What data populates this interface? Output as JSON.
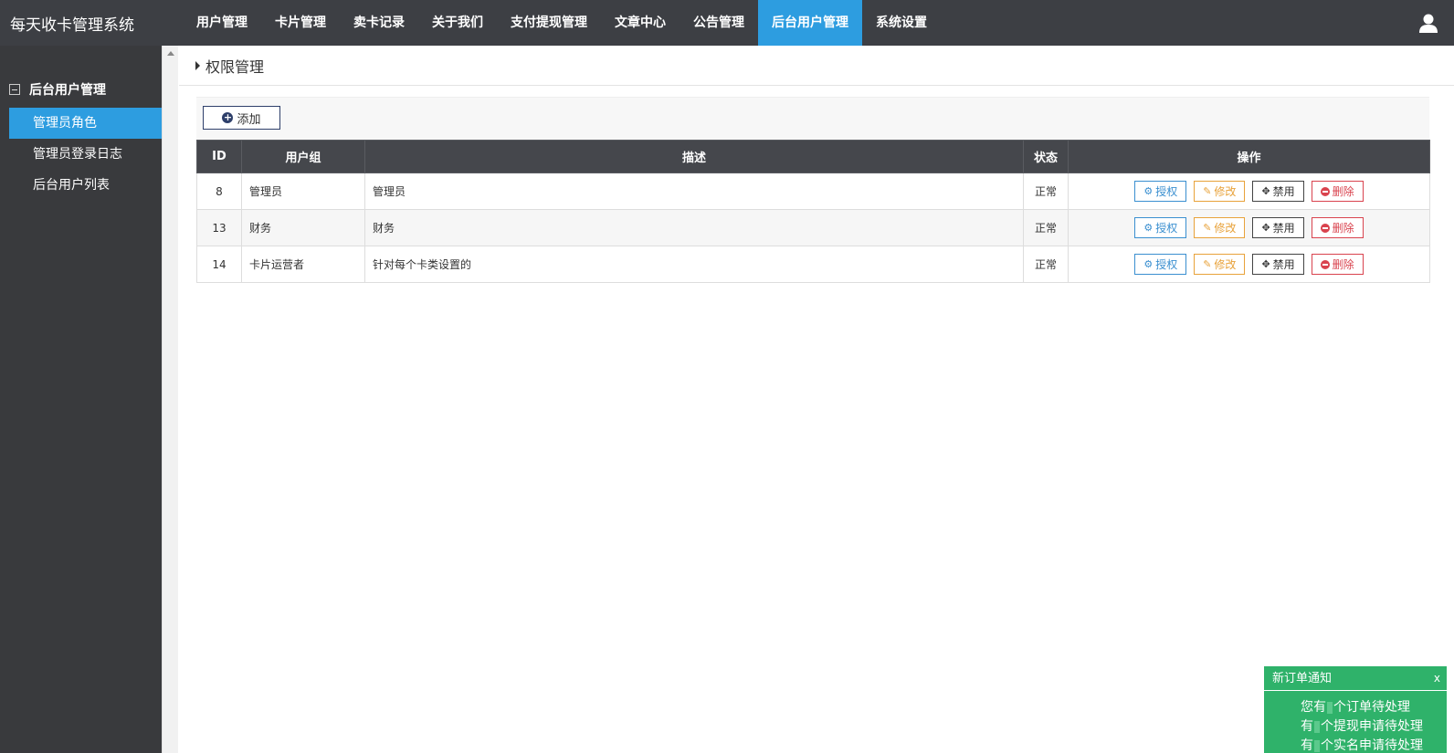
{
  "topbar": {
    "brand": "每天收卡管理系统",
    "nav": [
      {
        "label": "用户管理",
        "active": false
      },
      {
        "label": "卡片管理",
        "active": false
      },
      {
        "label": "卖卡记录",
        "active": false
      },
      {
        "label": "关于我们",
        "active": false
      },
      {
        "label": "支付提现管理",
        "active": false
      },
      {
        "label": "文章中心",
        "active": false
      },
      {
        "label": "公告管理",
        "active": false
      },
      {
        "label": "后台用户管理",
        "active": true
      },
      {
        "label": "系统设置",
        "active": false
      }
    ],
    "user_icon": "user-icon"
  },
  "sidebar": {
    "group_label": "后台用户管理",
    "items": [
      {
        "label": "管理员角色",
        "active": true
      },
      {
        "label": "管理员登录日志",
        "active": false
      },
      {
        "label": "后台用户列表",
        "active": false
      }
    ]
  },
  "main": {
    "title": "权限管理",
    "add_label": "添加",
    "table": {
      "headers": [
        "ID",
        "用户组",
        "描述",
        "状态",
        "操作"
      ],
      "rows": [
        {
          "id": "8",
          "group": "管理员",
          "desc": "管理员",
          "status": "正常"
        },
        {
          "id": "13",
          "group": "财务",
          "desc": "财务",
          "status": "正常"
        },
        {
          "id": "14",
          "group": "卡片运营者",
          "desc": "针对每个卡类设置的",
          "status": "正常"
        }
      ],
      "actions": {
        "auth": "授权",
        "edit": "修改",
        "ban": "禁用",
        "del": "删除"
      }
    }
  },
  "notify": {
    "title": "新订单通知",
    "close": "x",
    "line1_pre": "您有",
    "line1_post": "个订单待处理",
    "line2_pre": "有",
    "line2_post": "个提现申请待处理",
    "line3_pre": "有",
    "line3_post": "个实名申请待处理"
  },
  "colors": {
    "topbar": "#3d3f44",
    "sidebar": "#393a3d",
    "accent": "#2d9de0",
    "notify": "#2fb26a"
  }
}
